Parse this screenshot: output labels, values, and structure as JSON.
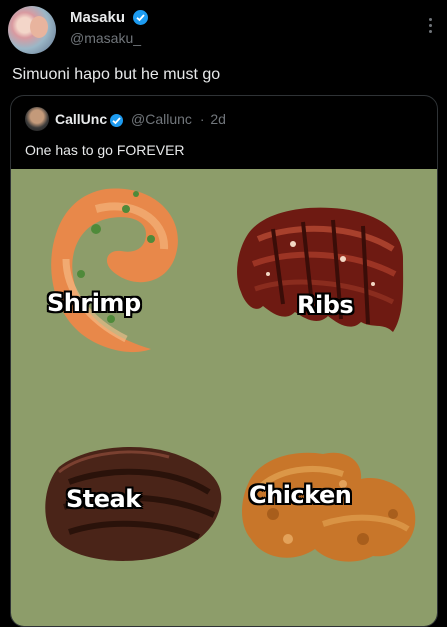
{
  "post": {
    "author_name": "Masaku",
    "author_handle": "@masaku_",
    "text": "Simuoni hapo but he must go"
  },
  "quote": {
    "author_name": "CallUnc",
    "author_handle": "@Callunc",
    "separator": "·",
    "time": "2d",
    "text": "One has to go FOREVER"
  },
  "media": {
    "background": "#8d9d6a",
    "items": [
      {
        "label": "Shrimp",
        "icon": "shrimp"
      },
      {
        "label": "Ribs",
        "icon": "ribs"
      },
      {
        "label": "Steak",
        "icon": "steak"
      },
      {
        "label": "Chicken",
        "icon": "fried-chicken"
      }
    ]
  },
  "colors": {
    "verified": "#1d9bf0",
    "text": "#e7e9ea",
    "muted": "#71767b"
  }
}
